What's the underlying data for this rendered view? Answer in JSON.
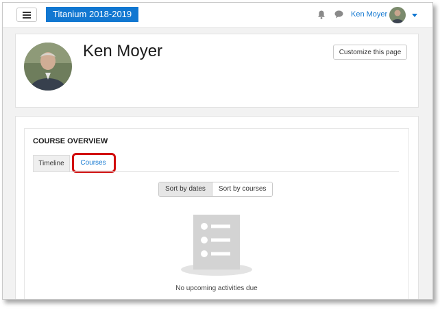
{
  "navbar": {
    "menu_icon": "hamburger-menu-icon",
    "site_name": "Titanium 2018-2019",
    "notifications_icon": "bell-icon",
    "messages_icon": "chat-bubble-icon",
    "user_name": "Ken Moyer",
    "user_menu_icon": "caret-down-icon",
    "brand_color": "#1177d1"
  },
  "profile": {
    "name": "Ken Moyer",
    "customize_label": "Customize this page"
  },
  "course_overview": {
    "title": "COURSE OVERVIEW",
    "tabs": [
      {
        "label": "Timeline",
        "active": false
      },
      {
        "label": "Courses",
        "active": true
      }
    ],
    "highlight_color": "#d10a0a",
    "sort_options": [
      {
        "label": "Sort by dates",
        "selected": true
      },
      {
        "label": "Sort by courses",
        "selected": false
      }
    ],
    "empty_icon": "empty-list-document-icon",
    "empty_message": "No upcoming activities due"
  }
}
